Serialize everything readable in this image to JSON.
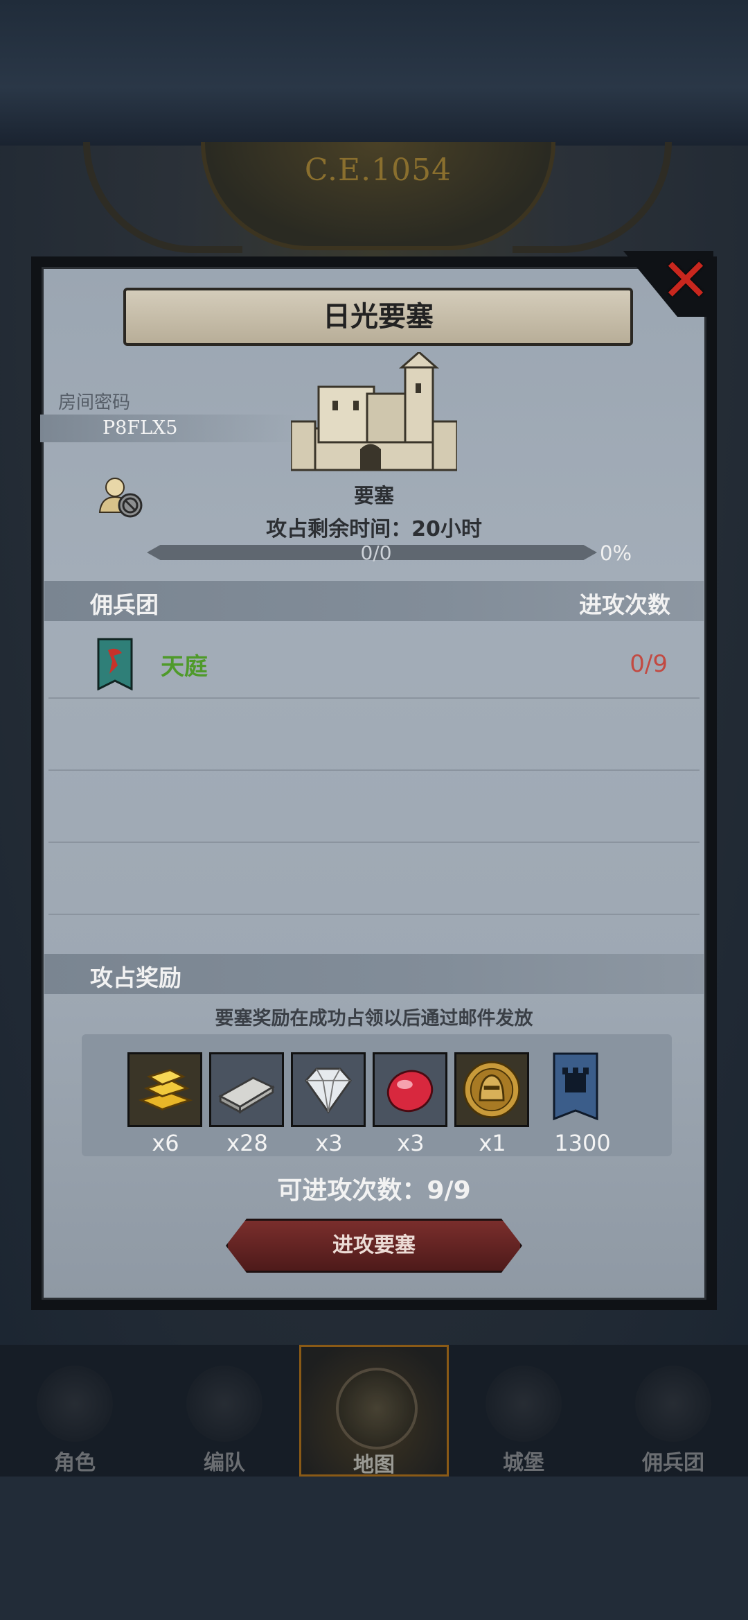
{
  "header": {
    "era_date": "C.E.1054"
  },
  "dialog": {
    "title": "日光要塞",
    "room_password_label": "房间密码",
    "room_password": "P8FLX5",
    "building_label": "要塞",
    "time_remaining": "攻占剩余时间：20小时",
    "progress": {
      "text": "0/0",
      "percent_label": "0%",
      "fraction": 0
    },
    "guild_header": "佣兵团",
    "attacks_header": "进攻次数",
    "guilds": [
      {
        "name": "天庭",
        "attacks": "0/9",
        "name_color": "#4f9a2a"
      }
    ],
    "reward_header": "攻占奖励",
    "reward_note": "要塞奖励在成功占领以后通过邮件发放",
    "rewards": [
      {
        "icon": "gold-bar-icon",
        "qty": "x6"
      },
      {
        "icon": "iron-bar-icon",
        "qty": "x28"
      },
      {
        "icon": "diamond-icon",
        "qty": "x3"
      },
      {
        "icon": "ruby-icon",
        "qty": "x3"
      },
      {
        "icon": "knight-helmet-medal-icon",
        "qty": "x1"
      },
      {
        "icon": "castle-banner-icon",
        "qty": "1300"
      }
    ],
    "attempts_text": "可进攻次数：9/9",
    "attack_button": "进攻要塞"
  },
  "nav": {
    "items": [
      {
        "label": "角色",
        "active": false
      },
      {
        "label": "编队",
        "active": false
      },
      {
        "label": "地图",
        "active": true
      },
      {
        "label": "城堡",
        "active": false
      },
      {
        "label": "佣兵团",
        "active": false
      }
    ]
  },
  "colors": {
    "accent_red": "#c8271e",
    "guild_green": "#4f9a2a",
    "attack_red": "#c24a42"
  }
}
